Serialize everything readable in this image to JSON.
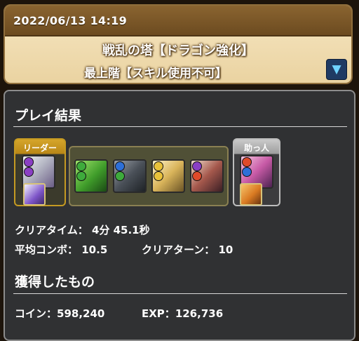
{
  "header": {
    "timestamp": "2022/06/13 14:19",
    "dungeon_name": "戦乱の塔【ドラゴン強化】",
    "floor_name": "最上階【スキル使用不可】",
    "dropdown_icon": "▼"
  },
  "result": {
    "section_title": "プレイ結果",
    "leader_label": "リーダー",
    "helper_label": "助っ人",
    "clear_time_label": "クリアタイム：",
    "clear_time_value": "4分 45.1秒",
    "avg_combo_label": "平均コンボ：",
    "avg_combo_value": "10.5",
    "clear_turn_label": "クリアターン：",
    "clear_turn_value": "10"
  },
  "rewards": {
    "section_title": "獲得したもの",
    "coin_label": "コイン：",
    "coin_value": "598,240",
    "exp_label": "EXP：",
    "exp_value": "126,736"
  },
  "colors": {
    "header_bar": "#7a5628",
    "panel_bg": "#303133",
    "leader_frame": "#c59a22",
    "helper_frame": "#bdbdbd",
    "orb_dark": "#8a3fc4",
    "orb_wood": "#3eab3c",
    "orb_water": "#2d6fd8",
    "orb_light": "#e9c23a",
    "orb_fire": "#e04a2a"
  }
}
